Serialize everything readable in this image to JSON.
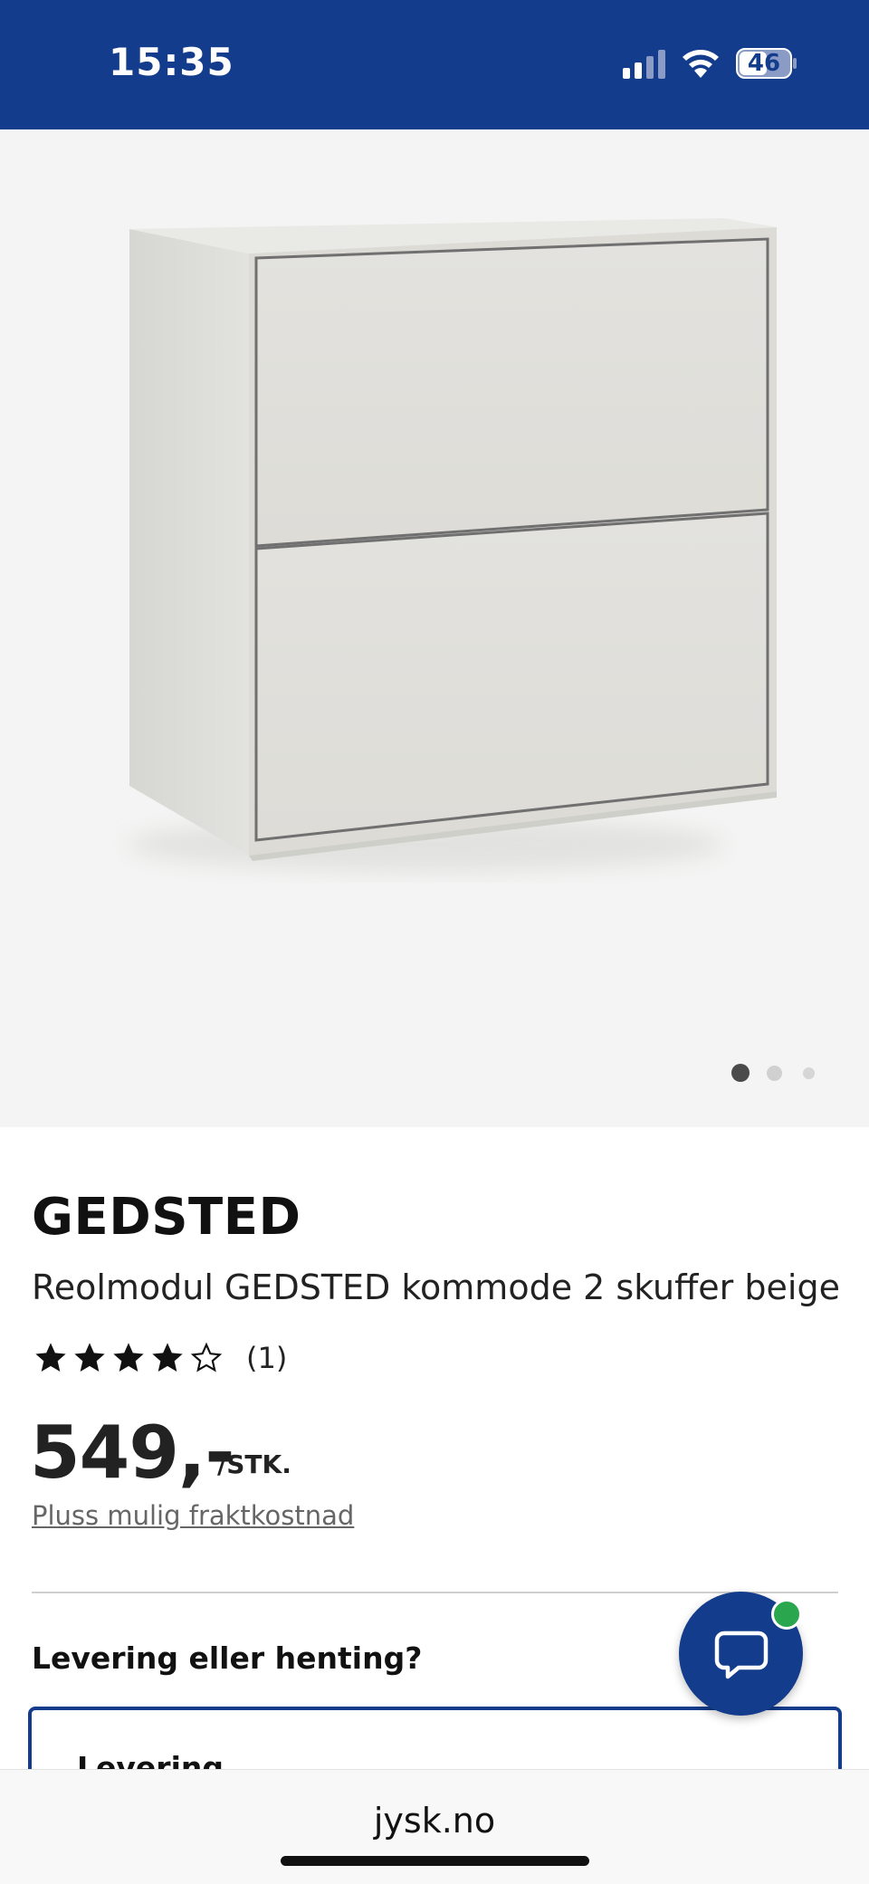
{
  "status_bar": {
    "time": "15:35",
    "battery_level": "46",
    "signal_icon": "cellular-signal-icon",
    "wifi_icon": "wifi-icon",
    "battery_icon": "battery-icon",
    "background_color": "#143c8c"
  },
  "gallery": {
    "image_description_icon": "wall-cabinet-two-drawers",
    "image_count": 3,
    "active_index": 0
  },
  "product": {
    "brand": "GEDSTED",
    "name": "Reolmodul GEDSTED kommode 2 skuffer beige",
    "rating": 4,
    "rating_max": 5,
    "rating_count_label": "(1)",
    "price": "549,-",
    "price_unit": "/STK.",
    "freight_link": "Pluss mulig fraktkostnad"
  },
  "delivery": {
    "heading": "Levering eller henting?",
    "option_label": "Levering"
  },
  "chat": {
    "icon": "chat-bubble-icon",
    "status_color": "#2aa64f"
  },
  "browser": {
    "url": "jysk.no"
  },
  "colors": {
    "brand_blue": "#143c8c",
    "gallery_bg": "#f4f4f4"
  }
}
